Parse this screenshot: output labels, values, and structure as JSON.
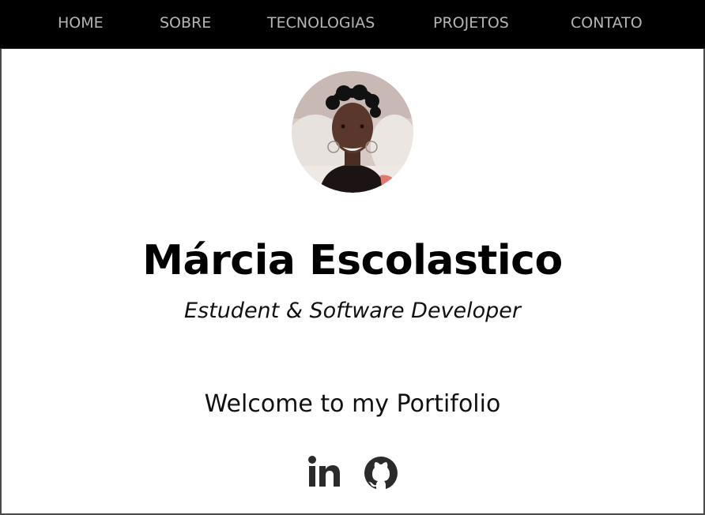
{
  "nav": {
    "items": [
      {
        "label": "HOME"
      },
      {
        "label": "SOBRE"
      },
      {
        "label": "TECNOLOGIAS"
      },
      {
        "label": "PROJETOS"
      },
      {
        "label": "CONTATO"
      }
    ]
  },
  "hero": {
    "name": "Márcia Escolastico",
    "subtitle": "Estudent & Software Developer",
    "welcome": "Welcome to my Portifolio"
  },
  "social": {
    "linkedin_icon": "linkedin-icon",
    "github_icon": "github-icon"
  },
  "colors": {
    "nav_background": "#000000",
    "nav_text": "#b5b5b5",
    "page_background": "#ffffff",
    "text": "#000000",
    "icon": "#2b2b2b"
  }
}
